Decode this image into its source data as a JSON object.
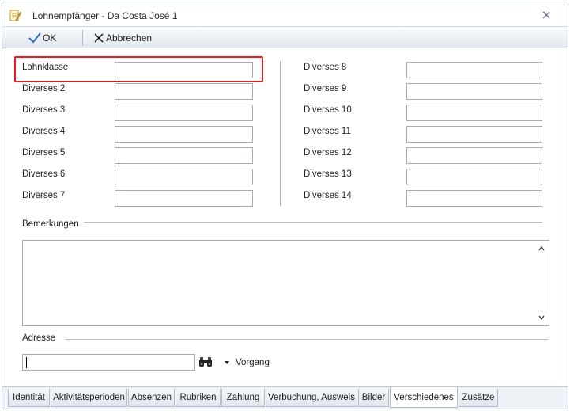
{
  "window": {
    "title": "Lohnempfänger - Da Costa José 1"
  },
  "toolbar": {
    "ok_label": "OK",
    "cancel_label": "Abbrechen"
  },
  "fields_left": [
    {
      "label": "Lohnklasse",
      "value": ""
    },
    {
      "label": "Diverses 2",
      "value": ""
    },
    {
      "label": "Diverses 3",
      "value": ""
    },
    {
      "label": "Diverses 4",
      "value": ""
    },
    {
      "label": "Diverses 5",
      "value": ""
    },
    {
      "label": "Diverses 6",
      "value": ""
    },
    {
      "label": "Diverses 7",
      "value": ""
    }
  ],
  "fields_right": [
    {
      "label": "Diverses 8",
      "value": ""
    },
    {
      "label": "Diverses 9",
      "value": ""
    },
    {
      "label": "Diverses 10",
      "value": ""
    },
    {
      "label": "Diverses 11",
      "value": ""
    },
    {
      "label": "Diverses 12",
      "value": ""
    },
    {
      "label": "Diverses 13",
      "value": ""
    },
    {
      "label": "Diverses 14",
      "value": ""
    }
  ],
  "remarks": {
    "label": "Bemerkungen",
    "value": ""
  },
  "address": {
    "label": "Adresse",
    "value": "",
    "vorgang_label": "Vorgang"
  },
  "tabs": [
    {
      "label": "Identität",
      "active": false
    },
    {
      "label": "Aktivitätsperioden",
      "active": false
    },
    {
      "label": "Absenzen",
      "active": false
    },
    {
      "label": "Rubriken",
      "active": false
    },
    {
      "label": "Zahlung",
      "active": false
    },
    {
      "label": "Verbuchung, Ausweis",
      "active": false
    },
    {
      "label": "Bilder",
      "active": false
    },
    {
      "label": "Verschiedenes",
      "active": true
    },
    {
      "label": "Zusätze",
      "active": false
    }
  ],
  "colors": {
    "highlight": "#e0201e",
    "ok_check": "#2b6cc4",
    "accent_border": "#a9b4c2"
  },
  "icons": {
    "app": "document-edit-icon",
    "close": "close-icon",
    "ok": "checkmark-icon",
    "cancel": "x-icon",
    "search": "binoculars-icon",
    "dropdown": "triangle-down-icon",
    "scroll_up": "chevron-up-icon",
    "scroll_down": "chevron-down-icon"
  }
}
